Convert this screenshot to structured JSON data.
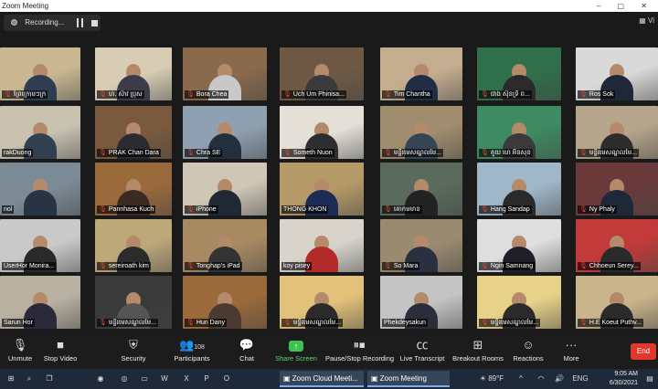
{
  "window": {
    "title": "Zoom Meeting",
    "controls": "– ▢ ✕"
  },
  "recording": {
    "label": "Recording..."
  },
  "view_label": "Vi",
  "colors": {
    "active_speaker": "#b7e24a",
    "mic_muted": "#e0423a",
    "share_green": "#3ec251",
    "end_red": "#e0362c"
  },
  "participants": [
    {
      "name": "ព្រែក្រោមៗក្រ",
      "muted": true
    },
    {
      "name": "ហ. ស៊ាវ ប្រុស",
      "muted": true
    },
    {
      "name": "Bora Chea",
      "muted": true
    },
    {
      "name": "Uch Um Phinisa...",
      "muted": true
    },
    {
      "name": "Tim Chantha",
      "muted": true
    },
    {
      "name": "ជាង ស៊ុនទ្រី ព...",
      "muted": true
    },
    {
      "name": "Ros Sok",
      "muted": true
    },
    {
      "name": "rakDuong",
      "muted": false
    },
    {
      "name": "PRAK Chan Dara",
      "muted": true
    },
    {
      "name": "Chra SE",
      "muted": true
    },
    {
      "name": "Someth Nuon",
      "muted": true
    },
    {
      "name": "មន្ទីរមេសណ្ឌលមៃ...",
      "muted": true
    },
    {
      "name": "គួយ ហេ អ៊ីនសុខ",
      "muted": true
    },
    {
      "name": "មន្ទីរមេសណ្ឌលមៃ...",
      "muted": true
    },
    {
      "name": "nol",
      "muted": false
    },
    {
      "name": "Pannhasa Kuch",
      "muted": true
    },
    {
      "name": "iPhone",
      "muted": true
    },
    {
      "name": "THONG KHON",
      "muted": false
    },
    {
      "name": "គោកមមាន",
      "muted": true
    },
    {
      "name": "Hang Sandap",
      "muted": true
    },
    {
      "name": "Ny Phaly",
      "muted": true
    },
    {
      "name": "UserHor Monira...",
      "muted": false
    },
    {
      "name": "sereiroath kim",
      "muted": true
    },
    {
      "name": "Tonghap's iPad",
      "muted": true
    },
    {
      "name": "koy pisey",
      "muted": false
    },
    {
      "name": "So Mara",
      "muted": true
    },
    {
      "name": "Ngin Samnang",
      "muted": true
    },
    {
      "name": "Chhoeun Serey...",
      "muted": true
    },
    {
      "name": "Sarun Hor",
      "muted": false
    },
    {
      "name": "មន្ទីរមេសណ្ឌលមៃ...",
      "muted": true
    },
    {
      "name": "Hun Dany",
      "muted": true
    },
    {
      "name": "មន្ទីរមេសណ្ឌលមៃ...",
      "muted": true
    },
    {
      "name": "Phekdeysakun",
      "muted": false
    },
    {
      "name": "មន្ទីរមេសណ្ឌលមៃ...",
      "muted": true
    },
    {
      "name": "H.E Koeut Puthv...",
      "muted": true
    }
  ],
  "toolbar": {
    "unmute": "Unmute",
    "stop_video": "Stop Video",
    "security": "Security",
    "participants": "Participants",
    "participants_count": "108",
    "chat": "Chat",
    "share_screen": "Share Screen",
    "recording": "Pause/Stop Recording",
    "live_transcript": "Live Transcript",
    "breakout_rooms": "Breakout Rooms",
    "reactions": "Reactions",
    "more": "More",
    "end": "End"
  },
  "taskbar": {
    "app1": "Zoom Cloud Meeti...",
    "app2": "Zoom Meeting",
    "weather": "89°F",
    "lang": "ENG",
    "time": "9:05 AM",
    "date": "6/30/2021"
  }
}
